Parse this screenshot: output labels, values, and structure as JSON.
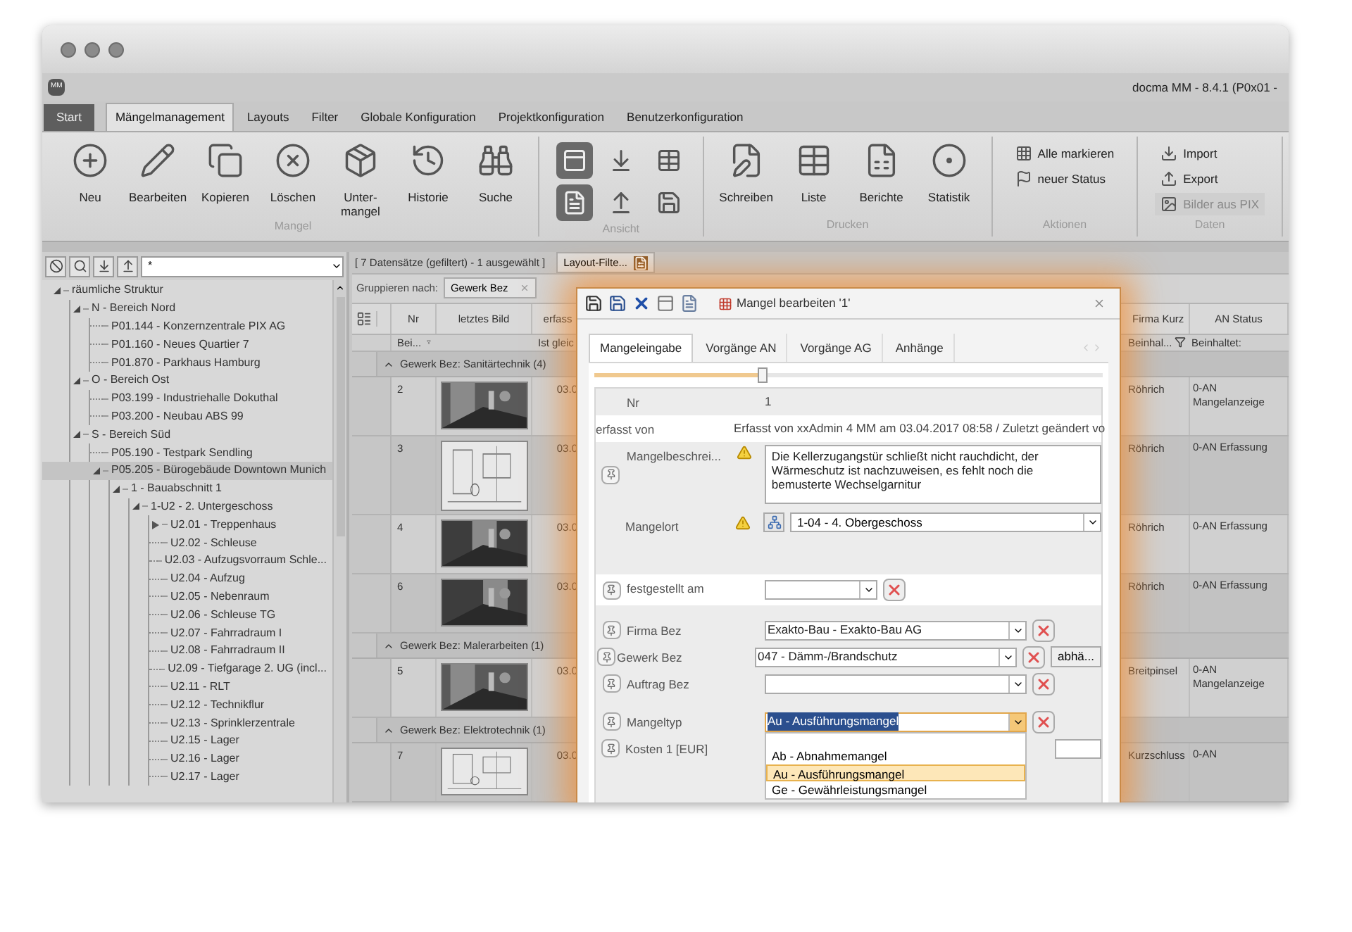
{
  "window": {
    "app_icon": "MM",
    "title": "docma MM - 8.4.1 (P0x01 -"
  },
  "ribbon_tabs": [
    {
      "label": "Start",
      "kind": "app",
      "selected": false
    },
    {
      "label": "Mängelmanagement",
      "kind": "tab",
      "selected": true
    },
    {
      "label": "Layouts",
      "kind": "tab",
      "selected": false
    },
    {
      "label": "Filter",
      "kind": "tab",
      "selected": false
    },
    {
      "label": "Globale Konfiguration",
      "kind": "tab",
      "selected": false
    },
    {
      "label": "Projektkonfiguration",
      "kind": "tab",
      "selected": false
    },
    {
      "label": "Benutzerkonfiguration",
      "kind": "tab",
      "selected": false
    }
  ],
  "ribbon_groups": [
    {
      "title": "Mangel",
      "kind": "large",
      "buttons": [
        {
          "label": "Neu"
        },
        {
          "label": "Bearbeiten"
        },
        {
          "label": "Kopieren"
        },
        {
          "label": "Löschen"
        },
        {
          "label": "Unter-\nmangel"
        },
        {
          "label": "Historie"
        },
        {
          "label": "Suche"
        }
      ]
    },
    {
      "title": "Ansicht",
      "kind": "toggles",
      "buttons": [
        {
          "selected": true
        },
        {
          "selected": false
        },
        {
          "selected": false
        },
        {
          "selected": true
        },
        {
          "selected": false
        },
        {
          "selected": false
        }
      ]
    },
    {
      "title": "Drucken",
      "kind": "large",
      "buttons": [
        {
          "label": "Schreiben"
        },
        {
          "label": "Liste"
        },
        {
          "label": "Berichte"
        },
        {
          "label": "Statistik"
        }
      ]
    },
    {
      "title": "Aktionen",
      "kind": "small",
      "buttons": [
        {
          "label": "Alle markieren",
          "disabled": false
        },
        {
          "label": "neuer Status",
          "disabled": false
        }
      ]
    },
    {
      "title": "Daten",
      "kind": "small",
      "buttons": [
        {
          "label": "Import",
          "disabled": false
        },
        {
          "label": "Export",
          "disabled": false
        },
        {
          "label": "Bilder aus PIX",
          "disabled": true
        }
      ]
    }
  ],
  "tree_filter": {
    "value": "*"
  },
  "tree": [
    {
      "label": "räumliche Struktur",
      "kind": "node",
      "expanded": true,
      "selected": false,
      "children": [
        {
          "label": "N - Bereich Nord",
          "kind": "node",
          "expanded": true,
          "selected": false,
          "children": [
            {
              "label": "P01.144 - Konzernzentrale PIX AG",
              "kind": "leaf",
              "selected": false
            },
            {
              "label": "P01.160 - Neues Quartier 7",
              "kind": "leaf",
              "selected": false
            },
            {
              "label": "P01.870  - Parkhaus Hamburg",
              "kind": "leaf",
              "selected": false
            }
          ]
        },
        {
          "label": "O - Bereich Ost",
          "kind": "node",
          "expanded": true,
          "selected": false,
          "children": [
            {
              "label": "P03.199 - Industriehalle Dokuthal",
              "kind": "leaf",
              "selected": false
            },
            {
              "label": "P03.200 - Neubau ABS 99",
              "kind": "leaf",
              "selected": false
            }
          ]
        },
        {
          "label": "S - Bereich Süd",
          "kind": "node",
          "expanded": true,
          "selected": false,
          "children": [
            {
              "label": "P05.190 - Testpark Sendling",
              "kind": "leaf",
              "selected": false
            },
            {
              "label": "P05.205 - Bürogebäude Downtown Munich",
              "kind": "node",
              "expanded": true,
              "selected": true,
              "children": [
                {
                  "label": "1 - Bauabschnitt 1",
                  "kind": "node",
                  "expanded": true,
                  "selected": false,
                  "children": [
                    {
                      "label": "1-U2 - 2. Untergeschoss",
                      "kind": "node",
                      "expanded": true,
                      "selected": false,
                      "children": [
                        {
                          "label": "U2.01 - Treppenhaus",
                          "kind": "node",
                          "expanded": false,
                          "selected": false
                        },
                        {
                          "label": "U2.02 - Schleuse",
                          "kind": "leaf",
                          "selected": false
                        },
                        {
                          "label": "U2.03  - Aufzugsvorraum Schle...",
                          "kind": "leaf",
                          "selected": false
                        },
                        {
                          "label": "U2.04 - Aufzug",
                          "kind": "leaf",
                          "selected": false
                        },
                        {
                          "label": "U2.05 - Nebenraum",
                          "kind": "leaf",
                          "selected": false
                        },
                        {
                          "label": "U2.06 - Schleuse TG",
                          "kind": "leaf",
                          "selected": false
                        },
                        {
                          "label": "U2.07 - Fahrradraum I",
                          "kind": "leaf",
                          "selected": false
                        },
                        {
                          "label": "U2.08 - Fahrradraum II",
                          "kind": "leaf",
                          "selected": false
                        },
                        {
                          "label": "U2.09 - Tiefgarage 2. UG (incl...",
                          "kind": "leaf",
                          "selected": false
                        },
                        {
                          "label": "U2.11 - RLT",
                          "kind": "leaf",
                          "selected": false
                        },
                        {
                          "label": "U2.12 - Technikflur",
                          "kind": "leaf",
                          "selected": false
                        },
                        {
                          "label": "U2.13 - Sprinklerzentrale",
                          "kind": "leaf",
                          "selected": false
                        },
                        {
                          "label": "U2.15 - Lager",
                          "kind": "leaf",
                          "selected": false
                        },
                        {
                          "label": "U2.16 - Lager",
                          "kind": "leaf",
                          "selected": false
                        },
                        {
                          "label": "U2.17 - Lager",
                          "kind": "leaf",
                          "selected": false
                        }
                      ]
                    }
                  ]
                }
              ]
            }
          ]
        }
      ]
    }
  ],
  "grid": {
    "status": "[ 7 Datensätze (gefiltert) - 1 ausgewählt ]",
    "layout_button": "Layout-Filte...",
    "group_by_label": "Gruppieren nach:",
    "group_chip": "Gewerk Bez",
    "columns": [
      {
        "label": "Nr",
        "filter": "Bei...",
        "funnel": true
      },
      {
        "label": "letztes Bild"
      },
      {
        "label": "erfass",
        "filter": "Ist gleic"
      },
      {
        "label": "Firma Kurz",
        "filter": "Beinhal...",
        "funnel": true
      },
      {
        "label": "AN Status",
        "filter": "Beinhaltet:"
      }
    ],
    "groups": [
      {
        "title": "Gewerk Bez: Sanitärtechnik (4)",
        "expanded": true,
        "rows": [
          {
            "nr": "2",
            "date": "03.0",
            "firma": "Röhrich",
            "status": "0-AN Mangelanzeige"
          },
          {
            "nr": "3",
            "date": "03.0",
            "firma": "Röhrich",
            "status": "0-AN Erfassung"
          },
          {
            "nr": "4",
            "date": "03.0",
            "firma": "Röhrich",
            "status": "0-AN Erfassung"
          },
          {
            "nr": "6",
            "date": "03.0",
            "firma": "Röhrich",
            "status": "0-AN Erfassung"
          }
        ]
      },
      {
        "title": "Gewerk Bez: Malerarbeiten (1)",
        "expanded": true,
        "rows": [
          {
            "nr": "5",
            "date": "03.0",
            "firma": "Breitpinsel",
            "status": "0-AN Mangelanzeige"
          }
        ]
      },
      {
        "title": "Gewerk Bez: Elektrotechnik (1)",
        "expanded": true,
        "rows": [
          {
            "nr": "7",
            "date": "03.0",
            "firma": "Kurzschluss",
            "status": "0-AN"
          }
        ]
      }
    ]
  },
  "dialog": {
    "title": "Mangel bearbeiten '1'",
    "tabs": [
      {
        "label": "Mangeleingabe",
        "selected": true
      },
      {
        "label": "Vorgänge AN",
        "selected": false
      },
      {
        "label": "Vorgänge AG",
        "selected": false
      },
      {
        "label": "Anhänge",
        "selected": false
      }
    ],
    "splitter": {
      "level": 0.33
    },
    "fields": [
      {
        "kind": "text",
        "label": "Nr",
        "value": "1",
        "pin": false,
        "warning": false,
        "white": false
      },
      {
        "kind": "text",
        "label": "erfasst von",
        "value": "Erfasst von xxAdmin 4 MM am 03.04.2017 08:58 / Zuletzt geändert vo",
        "pin": false,
        "warning": false,
        "white": true
      },
      {
        "kind": "memo",
        "label": "Mangelbeschrei...",
        "value": "Die Kellerzugangstür schließt nicht rauchdicht, der Wärmeschutz ist nachzuweisen, es fehlt noch die bemusterte Wechselgarnitur",
        "pin": true,
        "warning": true,
        "white": false
      },
      {
        "kind": "location",
        "label": "Mangelort",
        "value": "1-04 - 4. Obergeschoss",
        "pin": false,
        "warning": true,
        "white": false
      },
      {
        "kind": "date",
        "label": "festgestellt am",
        "pin": true,
        "warning": false,
        "white": true
      },
      {
        "kind": "select",
        "label": "Firma Bez",
        "value": "Exakto-Bau - Exakto-Bau AG",
        "pin": true,
        "warning": false,
        "white": false
      },
      {
        "kind": "select",
        "label": "Gewerk Bez",
        "value": "047 - Dämm-/Brandschutz",
        "extra_button": "abhä...",
        "pin": true,
        "warning": false,
        "white": false
      },
      {
        "kind": "select",
        "label": "Auftrag Bez",
        "pin": true,
        "warning": false,
        "white": false
      },
      {
        "kind": "select",
        "label": "Mangeltyp",
        "value": "Au - Ausführungsmangel",
        "open": true,
        "pin": true,
        "warning": false,
        "white": false,
        "options": [
          {
            "label": "Ab - Abnahmemangel",
            "selected": false
          },
          {
            "label": "Au - Ausführungsmangel",
            "selected": true
          },
          {
            "label": "Ge - Gewährleistungsmangel",
            "selected": false
          }
        ]
      },
      {
        "kind": "number",
        "label": "Kosten 1 [EUR]",
        "pin": true,
        "warning": false,
        "white": false
      }
    ]
  }
}
